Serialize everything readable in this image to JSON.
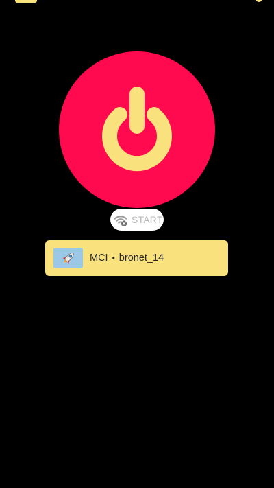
{
  "colors": {
    "background": "#000000",
    "power_button": "#FF0A4E",
    "accent_yellow": "#F9E27D",
    "pill_bg": "#FFFFFF",
    "pill_text": "#B9B9B9",
    "thumb_bg": "#9CC8E8"
  },
  "header": {
    "menu_icon": "menu-icon",
    "share_icon": "share-icon"
  },
  "power": {
    "icon": "power-icon"
  },
  "status": {
    "icon": "wifi-off-icon",
    "label": "START"
  },
  "server": {
    "icon": "rocket-icon",
    "provider": "MCI",
    "separator": "•",
    "name": "bronet_14"
  }
}
